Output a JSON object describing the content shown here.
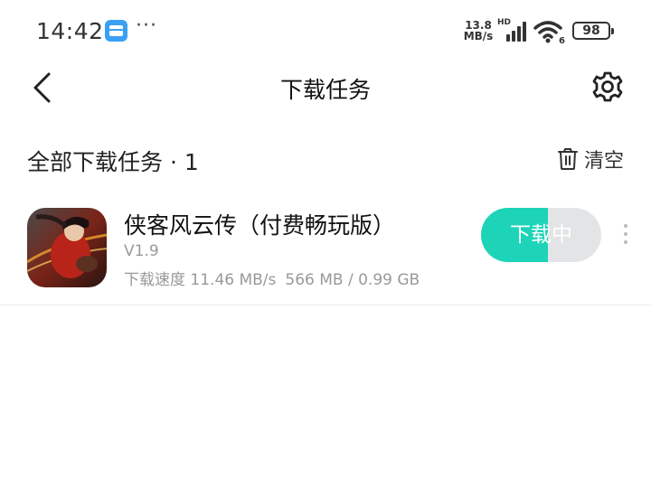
{
  "status_bar": {
    "time": "14:42",
    "more": "···",
    "net_speed_value": "13.8",
    "net_speed_unit": "MB/s",
    "signal_label": "HD",
    "wifi_label": "6",
    "battery": "98"
  },
  "header": {
    "title": "下载任务",
    "icons": [
      "back-icon",
      "settings-icon"
    ]
  },
  "section": {
    "title": "全部下载任务",
    "count": "· 1",
    "clear_label": "清空"
  },
  "tasks": [
    {
      "name": "侠客风云传（付费畅玩版）",
      "version": "V1.9",
      "speed_text": "下载速度 11.46 MB/s",
      "size_text": "566 MB / 0.99 GB",
      "button_label": "下载中",
      "progress": 0.56
    }
  ],
  "colors": {
    "accent": "#1dd4b8",
    "track": "#e2e4e6",
    "messages_icon": "#3aa0f5"
  }
}
